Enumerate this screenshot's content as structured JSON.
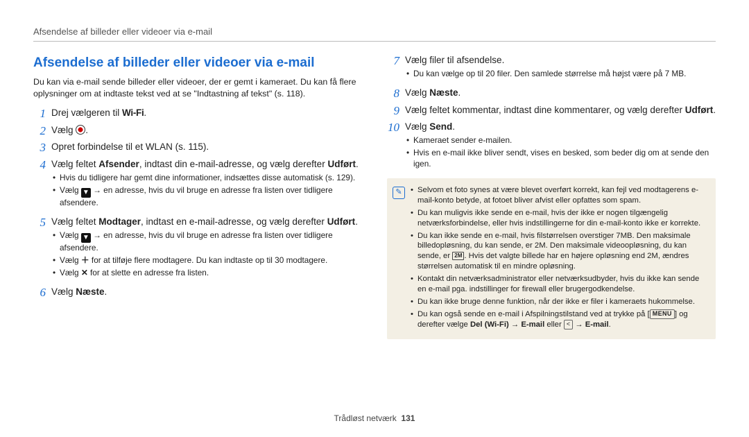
{
  "header": {
    "breadcrumb": "Afsendelse af billeder eller videoer via e-mail"
  },
  "section": {
    "title": "Afsendelse af billeder eller videoer via e-mail",
    "intro": "Du kan via e-mail sende billeder eller videoer, der er gemt i kameraet. Du kan få flere oplysninger om at indtaste tekst ved at se \"Indtastning af tekst\" (s. 118)."
  },
  "steps_left": {
    "s1": {
      "num": "1",
      "pre": "Drej vælgeren til ",
      "wifi": "Wi-Fi",
      "post": "."
    },
    "s2": {
      "num": "2",
      "pre": "Vælg ",
      "post": "."
    },
    "s3": {
      "num": "3",
      "text": "Opret forbindelse til et WLAN (s. 115)."
    },
    "s4": {
      "num": "4",
      "html_pre": "Vælg feltet ",
      "bold1": "Afsender",
      "mid": ", indtast din e-mail-adresse, og vælg derefter ",
      "bold2": "Udført",
      "post": ".",
      "bullets": [
        "Hvis du tidligere har gemt dine informationer, indsættes disse automatisk (s. 129).",
        "Vælg ▼ → en adresse, hvis du vil bruge en adresse fra listen over tidligere afsendere."
      ]
    },
    "s5": {
      "num": "5",
      "html_pre": "Vælg feltet ",
      "bold1": "Modtager",
      "mid": ", indtast en e-mail-adresse, og vælg derefter ",
      "bold2": "Udført",
      "post": ".",
      "bullets": [
        "Vælg ▼ → en adresse, hvis du vil bruge en adresse fra listen over tidligere afsendere.",
        "Vælg ＋ for at tilføje flere modtagere. Du kan indtaste op til 30 modtagere.",
        "Vælg ✕ for at slette en adresse fra listen."
      ]
    },
    "s6": {
      "num": "6",
      "pre": "Vælg ",
      "bold": "Næste",
      "post": "."
    }
  },
  "steps_right": {
    "s7": {
      "num": "7",
      "text": "Vælg filer til afsendelse.",
      "bullets": [
        "Du kan vælge op til 20 filer. Den samlede størrelse må højst være på 7 MB."
      ]
    },
    "s8": {
      "num": "8",
      "pre": "Vælg ",
      "bold": "Næste",
      "post": "."
    },
    "s9": {
      "num": "9",
      "pre": "Vælg feltet kommentar, indtast dine kommentarer, og vælg derefter ",
      "bold": "Udført",
      "post": "."
    },
    "s10": {
      "num": "10",
      "pre": "Vælg ",
      "bold": "Send",
      "post": ".",
      "bullets": [
        "Kameraet sender e-mailen.",
        "Hvis en e-mail ikke bliver sendt, vises en besked, som beder dig om at sende den igen."
      ]
    }
  },
  "note": {
    "items": [
      "Selvom et foto synes at være blevet overført korrekt, kan fejl ved modtagerens e-mail-konto betyde, at fotoet bliver afvist eller opfattes som spam.",
      "Du kan muligvis ikke sende en e-mail, hvis der ikke er nogen tilgængelig netværksforbindelse, eller hvis indstillingerne for din e-mail-konto ikke er korrekte.",
      "Du kan ikke sende en e-mail, hvis filstørrelsen overstiger 7MB. Den maksimale billedopløsning, du kan sende, er 2M. Den maksimale videoopløsning, du kan sende, er 2M. Hvis det valgte billede har en højere opløsning end 2M, ændres størrelsen automatisk til en mindre opløsning.",
      "Kontakt din netværksadministrator eller netværksudbyder, hvis du ikke kan sende en e-mail pga. indstillinger for firewall eller brugergodkendelse.",
      "Du kan ikke bruge denne funktion, når der ikke er filer i kameraets hukommelse."
    ],
    "last_pre": "Du kan også sende en e-mail i Afspilningstilstand ved at trykke på [",
    "last_menu": "MENU",
    "last_mid": "] og derefter vælge ",
    "last_b1": "Del (Wi-Fi)",
    "arrow": " → ",
    "last_b2": "E-mail",
    "last_or": " eller ",
    "last_share": "<",
    "last_b3": "E-mail",
    "last_post": "."
  },
  "footer": {
    "section": "Trådløst netværk",
    "page": "131"
  }
}
